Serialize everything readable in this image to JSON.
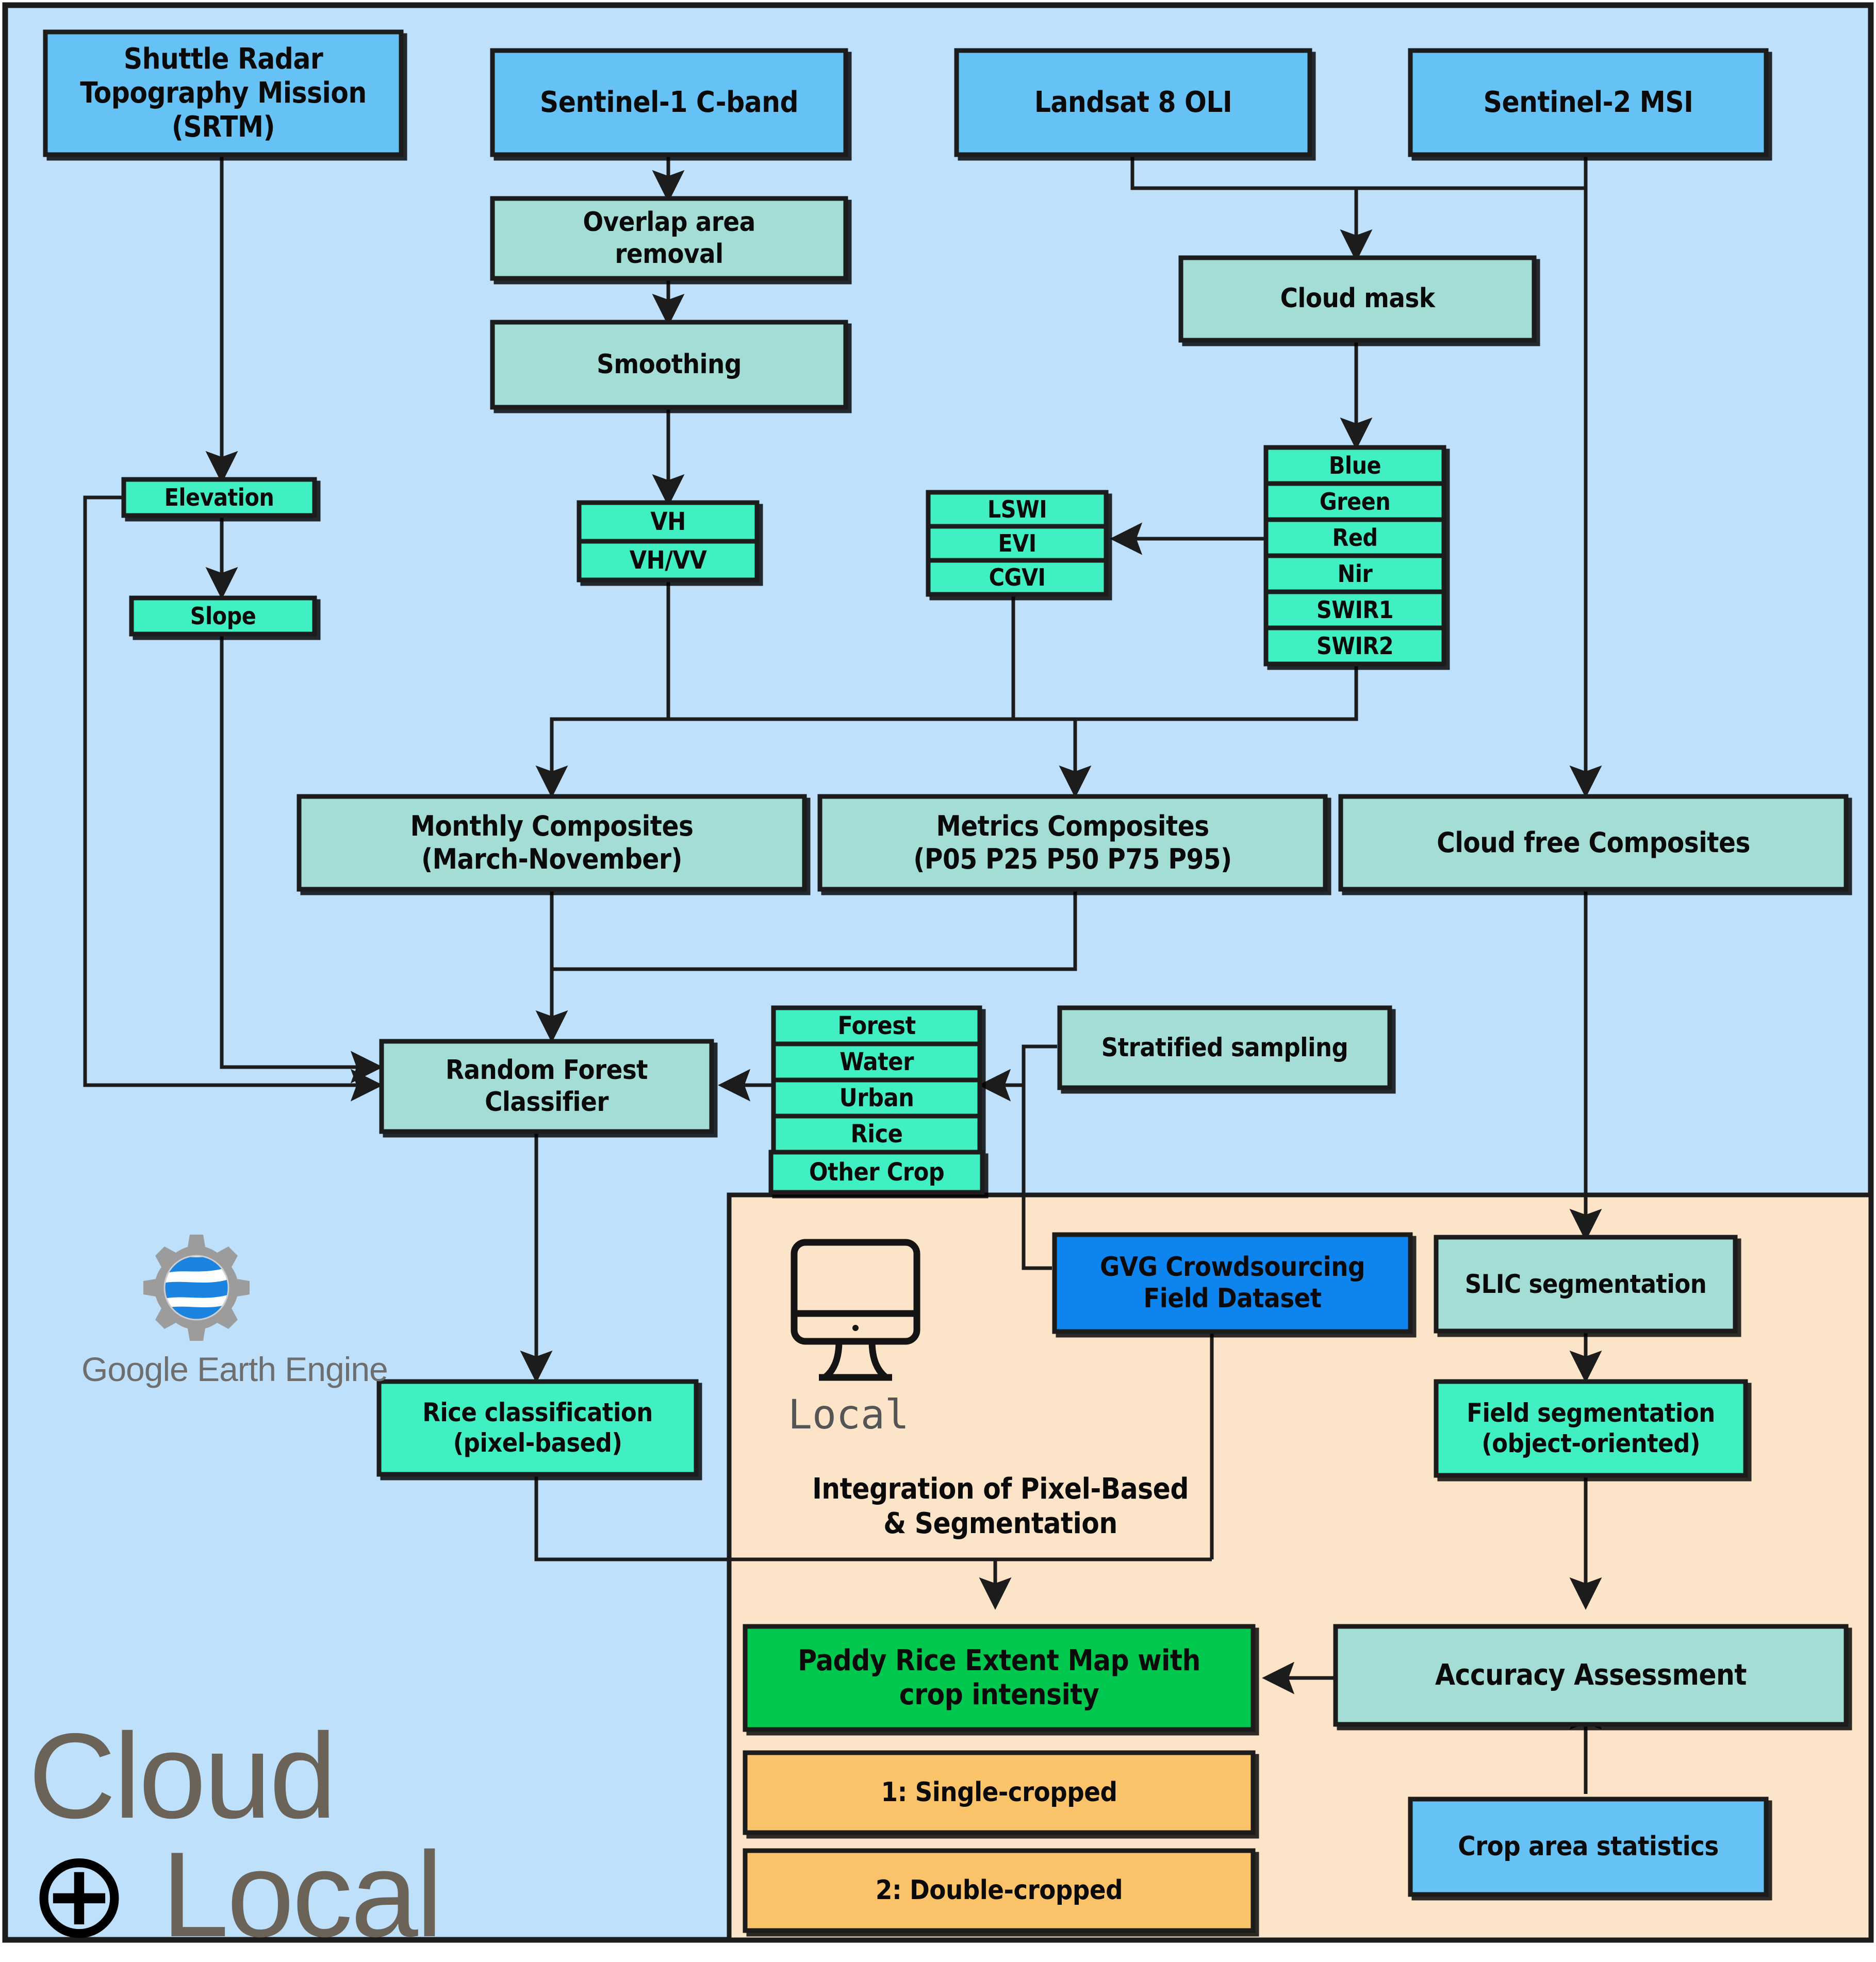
{
  "diagram": {
    "title": "Paddy rice mapping workflow (Cloud + Local)",
    "colors": {
      "cloud_panel": "#bfe0fb",
      "local_panel": "#fce4c8",
      "source_blue": "#66c2f5",
      "gvg_blue": "#1184ee",
      "crop_stats_blue": "#66c2f5",
      "process_teal": "#a3ddd5",
      "band_teal": "#3ff0c3",
      "output_green": "#00c74e",
      "legend_orange": "#fac36a",
      "stroke": "#1c1c1c",
      "gee_gray": "#9c9c9c",
      "gee_blue": "#1a84e0"
    },
    "panels": {
      "cloud_label_line1": "Cloud",
      "cloud_label_plus": "⊕",
      "cloud_label_line2": "Local",
      "local_label": "Local",
      "gee_label": "Google Earth Engine"
    },
    "nodes": {
      "srtm": "Shuttle Radar\nTopography Mission\n(SRTM)",
      "sentinel1": "Sentinel-1 C-band",
      "landsat8": "Landsat 8 OLI",
      "sentinel2": "Sentinel-2 MSI",
      "overlap_removal": "Overlap area\nremoval",
      "smoothing": "Smoothing",
      "cloud_mask": "Cloud mask",
      "elevation": "Elevation",
      "slope": "Slope",
      "vh": "VH",
      "vh_vv": "VH/VV",
      "lswi": "LSWI",
      "evi": "EVI",
      "cgvi": "CGVI",
      "band_blue": "Blue",
      "band_green": "Green",
      "band_red": "Red",
      "band_nir": "Nir",
      "band_swir1": "SWIR1",
      "band_swir2": "SWIR2",
      "monthly_composites": "Monthly Composites\n(March-November)",
      "metrics_composites": "Metrics Composites\n(P05 P25 P50 P75 P95)",
      "cloud_free_composites": "Cloud free Composites",
      "random_forest": "Random Forest\nClassifier",
      "class_forest": "Forest",
      "class_water": "Water",
      "class_urban": "Urban",
      "class_rice": "Rice",
      "class_other_crop": "Other Crop",
      "stratified_sampling": "Stratified sampling",
      "gvg_dataset": "GVG Crowdsourcing\nField Dataset",
      "slic_segmentation": "SLIC segmentation",
      "field_segmentation": "Field segmentation\n(object-oriented)",
      "rice_classification": "Rice classification\n(pixel-based)",
      "integration_note": "Integration of Pixel-Based\n& Segmentation",
      "paddy_rice_map": "Paddy Rice Extent Map with\ncrop intensity",
      "accuracy_assessment": "Accuracy Assessment",
      "crop_area_statistics": "Crop area statistics",
      "legend_single": "1: Single-cropped",
      "legend_double": "2: Double-cropped"
    }
  }
}
